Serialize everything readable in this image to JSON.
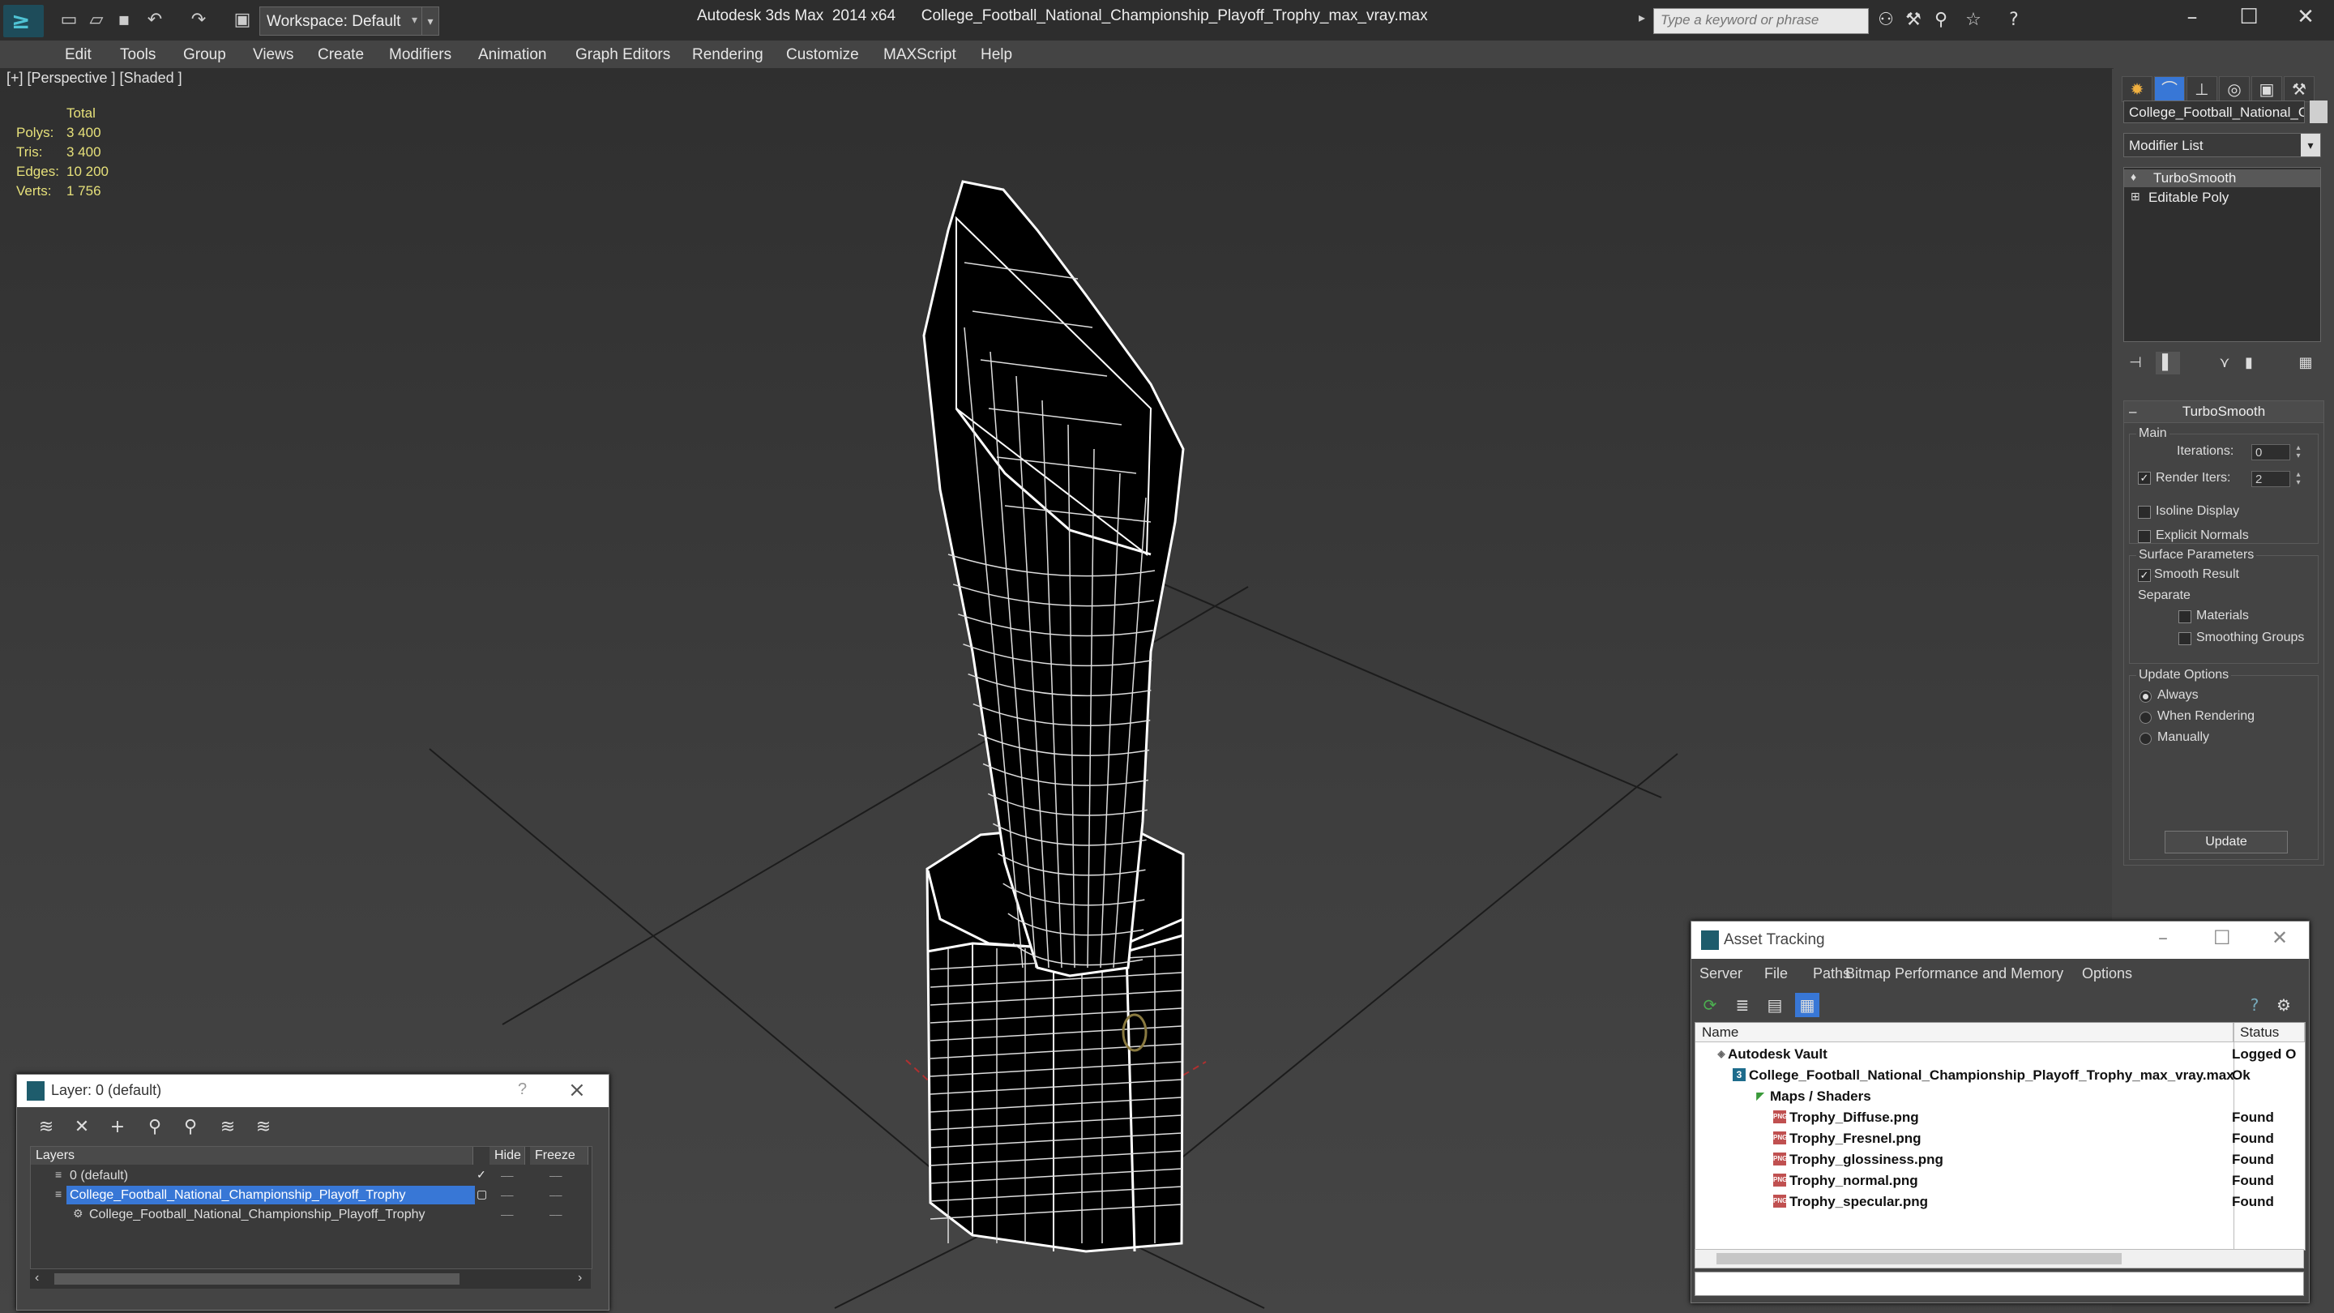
{
  "titlebar": {
    "workspace_label": "Workspace: Default",
    "app_title": "Autodesk 3ds Max  2014 x64",
    "file_title": "College_Football_National_Championship_Playoff_Trophy_max_vray.max",
    "search_placeholder": "Type a keyword or phrase"
  },
  "menu": [
    "Edit",
    "Tools",
    "Group",
    "Views",
    "Create",
    "Modifiers",
    "Animation",
    "Graph Editors",
    "Rendering",
    "Customize",
    "MAXScript",
    "Help"
  ],
  "viewport": {
    "label": "[+] [Perspective ] [Shaded ]",
    "stats": {
      "header": "Total",
      "rows": [
        {
          "label": "Polys:",
          "value": "3 400"
        },
        {
          "label": "Tris:",
          "value": "3 400"
        },
        {
          "label": "Edges:",
          "value": "10 200"
        },
        {
          "label": "Verts:",
          "value": "1 756"
        }
      ]
    }
  },
  "command_panel": {
    "object_name": "College_Football_National_Ch",
    "modifier_list": "Modifier List",
    "stack": [
      "TurboSmooth",
      "Editable Poly"
    ],
    "rollout": {
      "title": "TurboSmooth",
      "main_group": "Main",
      "iterations_label": "Iterations:",
      "iterations_value": "0",
      "render_iters_label": "Render Iters:",
      "render_iters_value": "2",
      "render_iters_checked": true,
      "isoline_label": "Isoline Display",
      "explicit_normals_label": "Explicit Normals",
      "surface_group": "Surface Parameters",
      "smooth_result_label": "Smooth Result",
      "separate_label": "Separate",
      "materials_label": "Materials",
      "smoothing_groups_label": "Smoothing Groups",
      "update_group": "Update Options",
      "always_label": "Always",
      "when_rendering_label": "When Rendering",
      "manually_label": "Manually",
      "update_button": "Update"
    }
  },
  "layer_dialog": {
    "title": "Layer: 0 (default)",
    "help": "?",
    "columns": {
      "layers": "Layers",
      "hide": "Hide",
      "freeze": "Freeze"
    },
    "rows": [
      {
        "name": "0 (default)"
      },
      {
        "name": "College_Football_National_Championship_Playoff_Trophy"
      },
      {
        "name": "College_Football_National_Championship_Playoff_Trophy"
      }
    ]
  },
  "asset_dialog": {
    "title": "Asset Tracking",
    "menu": [
      "Server",
      "File",
      "Paths",
      "Bitmap Performance and Memory",
      "Options"
    ],
    "columns": {
      "name": "Name",
      "status": "Status"
    },
    "rows": [
      {
        "name": "Autodesk Vault",
        "status": "Logged O"
      },
      {
        "name": "College_Football_National_Championship_Playoff_Trophy_max_vray.max",
        "status": "Ok"
      },
      {
        "name": "Maps / Shaders",
        "status": ""
      },
      {
        "name": "Trophy_Diffuse.png",
        "status": "Found"
      },
      {
        "name": "Trophy_Fresnel.png",
        "status": "Found"
      },
      {
        "name": "Trophy_glossiness.png",
        "status": "Found"
      },
      {
        "name": "Trophy_normal.png",
        "status": "Found"
      },
      {
        "name": "Trophy_specular.png",
        "status": "Found"
      }
    ]
  },
  "colors": {
    "accent": "#3877d6",
    "viewport_bg": "#3a3a3a",
    "stats_text": "#e6e07a",
    "wire": "#ffffff"
  }
}
